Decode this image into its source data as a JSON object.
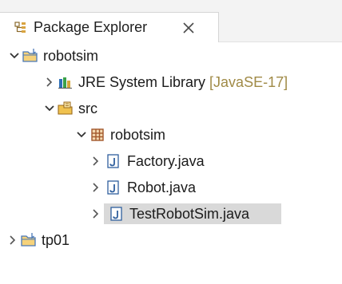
{
  "view": {
    "tab_title": "Package Explorer",
    "tab_icon": "package-explorer-icon",
    "close_icon": "close-icon"
  },
  "tree": [
    {
      "label": "robotsim",
      "kind": "project",
      "icon": "project-folder-icon",
      "expanded": true
    },
    {
      "label": "JRE System Library",
      "decoration": " [JavaSE-17]",
      "kind": "library",
      "icon": "library-icon",
      "expanded": false
    },
    {
      "label": "src",
      "kind": "source-folder",
      "icon": "source-folder-icon",
      "expanded": true
    },
    {
      "label": "robotsim",
      "kind": "package",
      "icon": "package-icon",
      "expanded": true
    },
    {
      "label": "Factory.java",
      "kind": "java-file",
      "icon": "java-file-icon",
      "expanded": false
    },
    {
      "label": "Robot.java",
      "kind": "java-file",
      "icon": "java-file-icon",
      "expanded": false
    },
    {
      "label": "TestRobotSim.java",
      "kind": "java-file",
      "icon": "java-file-icon",
      "expanded": false,
      "selected": true
    },
    {
      "label": "tp01",
      "kind": "project",
      "icon": "project-folder-icon",
      "expanded": false
    }
  ],
  "colors": {
    "selection": "#d9d9d9",
    "decoration": "#a08a46",
    "folder": "#e8b74a",
    "package": "#a2572b",
    "java": "#2f5f9e"
  }
}
